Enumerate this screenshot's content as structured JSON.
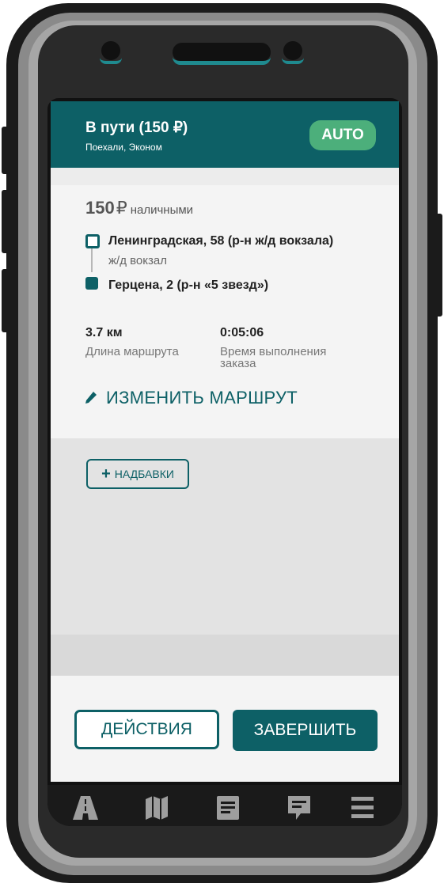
{
  "header": {
    "title": "В пути (150 ₽)",
    "subtitle": "Поехали, Эконом",
    "mode_badge": "AUTO"
  },
  "order": {
    "price_amount": "150",
    "price_currency": "₽",
    "payment_method": "наличными",
    "route": {
      "from": "Ленинградская, 58 (р-н ж/д вокзала)",
      "from_note": "ж/д вокзал",
      "to": "Герцена, 2 (р-н «5 звезд»)"
    },
    "distance": {
      "value": "3.7 км",
      "label": "Длина маршрута"
    },
    "duration": {
      "value": "0:05:06",
      "label_line1": "Время выполнения",
      "label_line2": "заказа"
    },
    "edit_route_label": "ИЗМЕНИТЬ МАРШРУТ"
  },
  "addons_label": "НАДБАВКИ",
  "actions": {
    "actions_label": "ДЕЙСТВИЯ",
    "finish_label": "ЗАВЕРШИТЬ"
  },
  "bottom_nav": [
    "road-icon",
    "map-icon",
    "document-icon",
    "chat-icon",
    "menu-icon"
  ],
  "colors": {
    "primary": "#0d6066",
    "accent_badge": "#4caf7b",
    "background": "#f4f4f4",
    "panel_grey": "#e3e3e3"
  }
}
